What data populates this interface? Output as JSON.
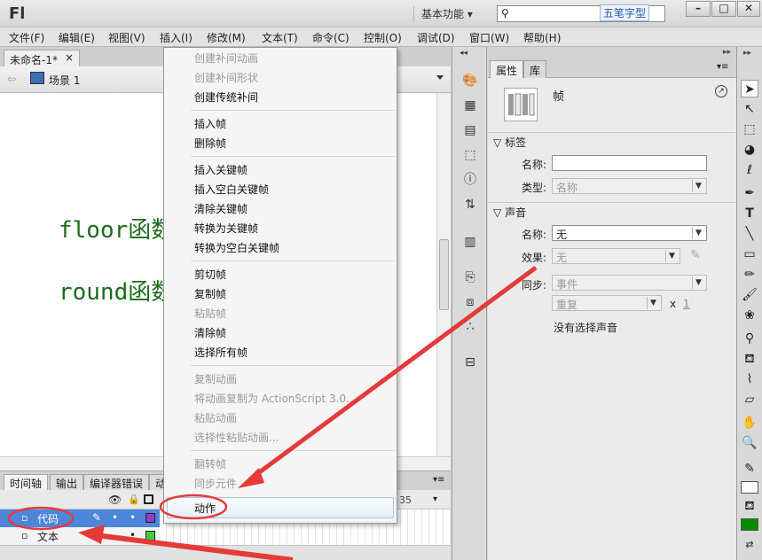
{
  "app": {
    "logo": "Fl",
    "workspace": "基本功能 ▾",
    "search_placeholder": "",
    "ime_label": "五笔字型",
    "win_min": "–",
    "win_max": "□",
    "win_close": "✕"
  },
  "menubar": [
    "文件(F)",
    "编辑(E)",
    "视图(V)",
    "插入(I)",
    "修改(M)",
    "文本(T)",
    "命令(C)",
    "控制(O)",
    "调试(D)",
    "窗口(W)",
    "帮助(H)"
  ],
  "document": {
    "tab": "未命名-1*",
    "tab_close": "×",
    "scene": "场景 1"
  },
  "stage": {
    "line1": "floor函数",
    "line2": "round函数"
  },
  "context_menu": [
    {
      "label": "创建补间动画",
      "enabled": false
    },
    {
      "label": "创建补间形状",
      "enabled": false
    },
    {
      "label": "创建传统补间",
      "enabled": true
    },
    {
      "label": "插入帧",
      "enabled": true
    },
    {
      "label": "删除帧",
      "enabled": true
    },
    {
      "label": "插入关键帧",
      "enabled": true
    },
    {
      "label": "插入空白关键帧",
      "enabled": true
    },
    {
      "label": "清除关键帧",
      "enabled": true
    },
    {
      "label": "转换为关键帧",
      "enabled": true
    },
    {
      "label": "转换为空白关键帧",
      "enabled": true
    },
    {
      "label": "剪切帧",
      "enabled": true
    },
    {
      "label": "复制帧",
      "enabled": true
    },
    {
      "label": "粘贴帧",
      "enabled": false
    },
    {
      "label": "清除帧",
      "enabled": true
    },
    {
      "label": "选择所有帧",
      "enabled": true
    },
    {
      "label": "复制动画",
      "enabled": false
    },
    {
      "label": "将动画复制为 ActionScript 3.0...",
      "enabled": false
    },
    {
      "label": "粘贴动画",
      "enabled": false
    },
    {
      "label": "选择性粘贴动画...",
      "enabled": false
    },
    {
      "label": "翻转帧",
      "enabled": false
    },
    {
      "label": "同步元件",
      "enabled": false
    },
    {
      "label": "动作",
      "enabled": true
    }
  ],
  "timeline": {
    "tabs": [
      "时间轴",
      "输出",
      "编译器错误",
      "动"
    ],
    "frame_number": "35",
    "layers": [
      {
        "name": "代码",
        "selected": true
      },
      {
        "name": "文本",
        "selected": false
      }
    ]
  },
  "properties": {
    "tabs": [
      "属性",
      "库"
    ],
    "type_label": "帧",
    "sections": {
      "label": "标签",
      "sound": "声音"
    },
    "name_label": "名称:",
    "name_value": "",
    "type_label_field": "类型:",
    "type_value": "名称",
    "sound_name_label": "名称:",
    "sound_name_value": "无",
    "effect_label": "效果:",
    "effect_value": "无",
    "sync_label": "同步:",
    "sync_value": "事件",
    "repeat_value": "重复",
    "repeat_x": "x",
    "repeat_count": "1",
    "no_sound": "没有选择声音"
  },
  "colors": {
    "accent": "#3b78c9",
    "annotation": "#e53a3a",
    "stage_text": "#1d6b1d"
  }
}
